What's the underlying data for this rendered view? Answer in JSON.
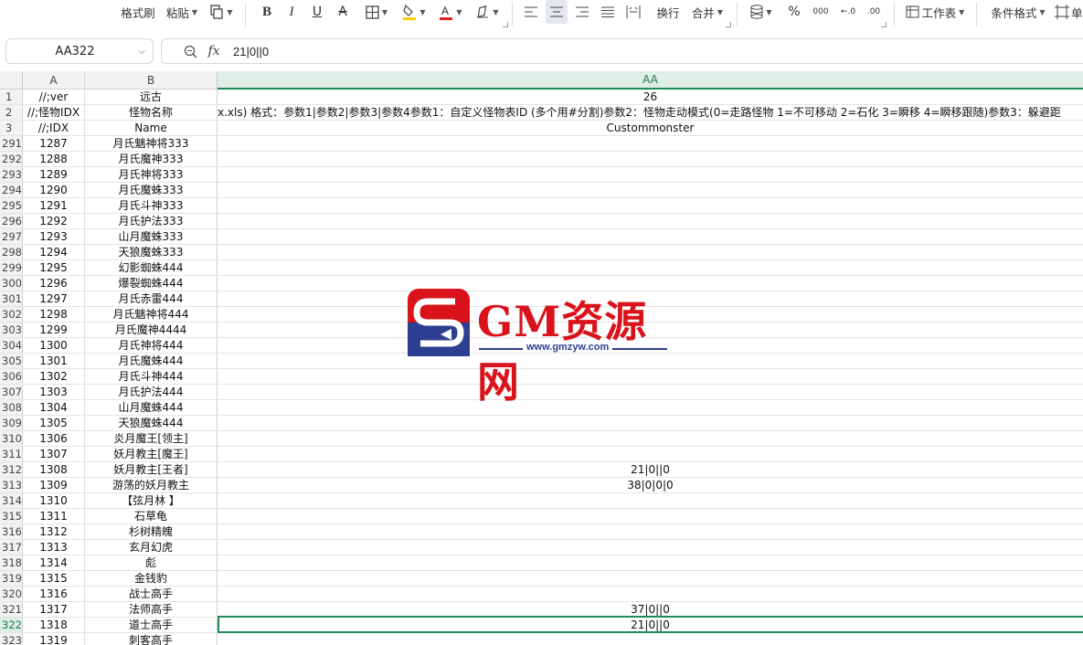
{
  "toolbar": {
    "format_painter": "格式刷",
    "paste": "粘贴",
    "wrap": "换行",
    "merge": "合并",
    "percent": "%",
    "thousands": "000",
    "dec_dec": "←.0",
    "inc_dec": ".00",
    "worksheet": "工作表",
    "cond_format": "条件格式",
    "cut_label": "单",
    "colors": {
      "highlight": "#f5d20a",
      "font_color": "#e0201a",
      "active_bg": "#e4e7ec"
    }
  },
  "formula_bar": {
    "name_box": "AA322",
    "fx_symbol": "fx",
    "content": "21|0||0"
  },
  "columns": {
    "a": "A",
    "b": "B",
    "aa": "AA"
  },
  "header_rows": [
    {
      "row": "1",
      "a": "//;ver",
      "b": "远古",
      "aa": "26"
    },
    {
      "row": "2",
      "a": "//;怪物IDX",
      "b": "怪物名称",
      "aa": "x.xls) 格式：参数1|参数2|参数3|参数4参数1：自定义怪物表ID (多个用#分割)参数2：怪物走动模式(0=走路怪物 1=不可移动 2=石化 3=瞬移 4=瞬移跟随)参数3：躲避距"
    },
    {
      "row": "3",
      "a": "//;IDX",
      "b": "Name",
      "aa": "Custommonster"
    }
  ],
  "data_rows": [
    {
      "row": "291",
      "a": "1287",
      "b": "月氏魑神将333",
      "aa": ""
    },
    {
      "row": "292",
      "a": "1288",
      "b": "月氏魔神333",
      "aa": ""
    },
    {
      "row": "293",
      "a": "1289",
      "b": "月氏神将333",
      "aa": ""
    },
    {
      "row": "294",
      "a": "1290",
      "b": "月氏魔蛛333",
      "aa": ""
    },
    {
      "row": "295",
      "a": "1291",
      "b": "月氏斗神333",
      "aa": ""
    },
    {
      "row": "296",
      "a": "1292",
      "b": "月氏护法333",
      "aa": ""
    },
    {
      "row": "297",
      "a": "1293",
      "b": "山月魔蛛333",
      "aa": ""
    },
    {
      "row": "298",
      "a": "1294",
      "b": "天狼魔蛛333",
      "aa": ""
    },
    {
      "row": "299",
      "a": "1295",
      "b": "幻影蜘蛛444",
      "aa": ""
    },
    {
      "row": "300",
      "a": "1296",
      "b": "爆裂蜘蛛444",
      "aa": ""
    },
    {
      "row": "301",
      "a": "1297",
      "b": "月氏赤雷444",
      "aa": ""
    },
    {
      "row": "302",
      "a": "1298",
      "b": "月氏魑神将444",
      "aa": ""
    },
    {
      "row": "303",
      "a": "1299",
      "b": "月氏魔神4444",
      "aa": ""
    },
    {
      "row": "304",
      "a": "1300",
      "b": "月氏神将444",
      "aa": ""
    },
    {
      "row": "305",
      "a": "1301",
      "b": "月氏魔蛛444",
      "aa": ""
    },
    {
      "row": "306",
      "a": "1302",
      "b": "月氏斗神444",
      "aa": ""
    },
    {
      "row": "307",
      "a": "1303",
      "b": "月氏护法444",
      "aa": ""
    },
    {
      "row": "308",
      "a": "1304",
      "b": "山月魔蛛444",
      "aa": ""
    },
    {
      "row": "309",
      "a": "1305",
      "b": "天狼魔蛛444",
      "aa": ""
    },
    {
      "row": "310",
      "a": "1306",
      "b": "炎月魔王[领主]",
      "aa": ""
    },
    {
      "row": "311",
      "a": "1307",
      "b": "妖月教主[魔王]",
      "aa": ""
    },
    {
      "row": "312",
      "a": "1308",
      "b": "妖月教主[王者]",
      "aa": "21|0||0"
    },
    {
      "row": "313",
      "a": "1309",
      "b": "游荡的妖月教主",
      "aa": "38|0|0|0"
    },
    {
      "row": "314",
      "a": "1310",
      "b": "【弦月林 】",
      "aa": ""
    },
    {
      "row": "315",
      "a": "1311",
      "b": "石草龟",
      "aa": ""
    },
    {
      "row": "316",
      "a": "1312",
      "b": "杉树精魄",
      "aa": ""
    },
    {
      "row": "317",
      "a": "1313",
      "b": "玄月幻虎",
      "aa": ""
    },
    {
      "row": "318",
      "a": "1314",
      "b": "彪",
      "aa": ""
    },
    {
      "row": "319",
      "a": "1315",
      "b": "金钱豹",
      "aa": ""
    },
    {
      "row": "320",
      "a": "1316",
      "b": "战士高手",
      "aa": ""
    },
    {
      "row": "321",
      "a": "1317",
      "b": "法师高手",
      "aa": "37|0||0"
    },
    {
      "row": "322",
      "a": "1318",
      "b": "道士高手",
      "aa": "21|0||0"
    },
    {
      "row": "323",
      "a": "1319",
      "b": "刺客高手",
      "aa": ""
    }
  ],
  "selected_row": "322",
  "watermark": {
    "brand": "GM资源网",
    "url": "www.gmzyw.com",
    "colors": {
      "red": "#d9121b",
      "blue": "#2d3f90"
    }
  }
}
